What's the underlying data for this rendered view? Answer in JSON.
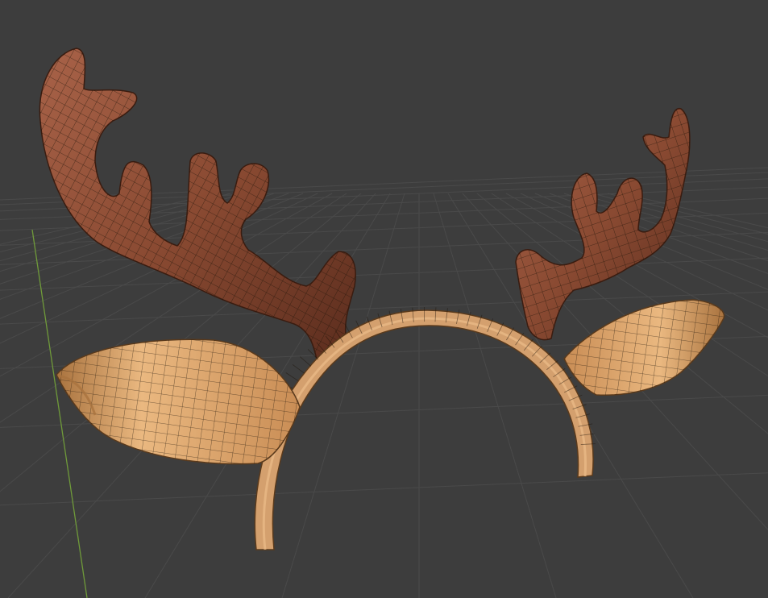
{
  "viewport": {
    "background_color": "#3d3d3d",
    "grid_line_color": "#4a4a4a",
    "y_axis_color": "#6f9a3a"
  },
  "model": {
    "objects": [
      {
        "name": "antler-left",
        "material_color": "#8a4a32",
        "highlight_color": "#a86248",
        "shadow_color": "#5a2c1d"
      },
      {
        "name": "antler-right",
        "material_color": "#8a4a32",
        "highlight_color": "#a86248",
        "shadow_color": "#5a2c1d"
      },
      {
        "name": "ear-left",
        "material_color": "#d9a06a",
        "highlight_color": "#eab880",
        "shadow_color": "#a9733f"
      },
      {
        "name": "ear-right",
        "material_color": "#d9a06a",
        "highlight_color": "#eab880",
        "shadow_color": "#a9733f"
      },
      {
        "name": "headband",
        "material_color": "#d4a06e",
        "highlight_color": "#e8b986",
        "shadow_color": "#9a6a3c"
      }
    ],
    "wireframe_color": "#1c1208",
    "wireframe_visible": true
  }
}
